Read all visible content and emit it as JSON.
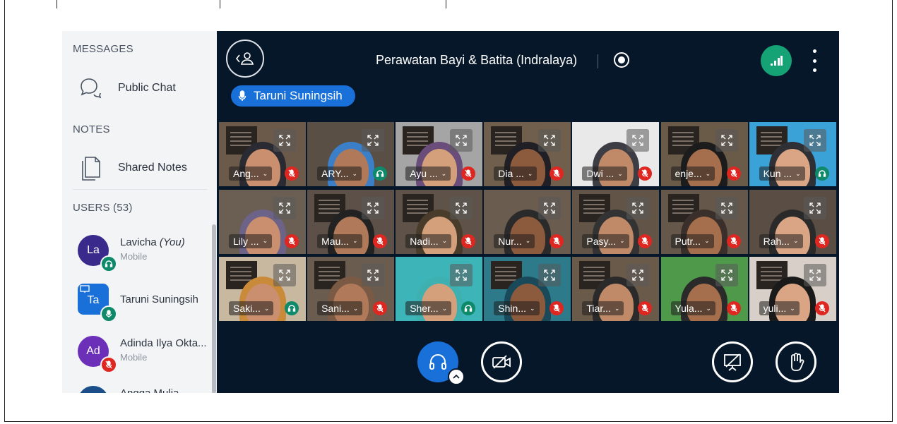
{
  "sidebar": {
    "messages_title": "MESSAGES",
    "public_chat_label": "Public Chat",
    "notes_title": "NOTES",
    "shared_notes_label": "Shared Notes",
    "users_title": "USERS (53)",
    "users": [
      {
        "initials": "La",
        "name": "Lavicha",
        "you_tag": "(You)",
        "device": "Mobile",
        "color": "#3a2a8c",
        "status": "listen"
      },
      {
        "initials": "Ta",
        "name": "Taruni Suningsih",
        "device": "",
        "color": "#1970d8",
        "status": "mic"
      },
      {
        "initials": "Ad",
        "name": "Adinda Ilya Okta...",
        "device": "Mobile",
        "color": "#6b2fb8",
        "status": "muted"
      },
      {
        "initials": "",
        "name": "Angga Mulia",
        "device": "",
        "color": "#1a4f8a",
        "status": ""
      }
    ]
  },
  "header": {
    "meeting_title": "Perawatan Bayi & Batita (Indralaya)",
    "talking_indicator": "Taruni Suningsih"
  },
  "video_tiles": [
    {
      "name": "Ang...",
      "status": "muted"
    },
    {
      "name": "ARY...",
      "status": "listen"
    },
    {
      "name": "Ayu ...",
      "status": "muted"
    },
    {
      "name": "Dia ...",
      "status": "muted"
    },
    {
      "name": "Dwi ...",
      "status": "muted"
    },
    {
      "name": "enje...",
      "status": "muted"
    },
    {
      "name": "Kun ...",
      "status": "listen"
    },
    {
      "name": "Lily ...",
      "status": "muted"
    },
    {
      "name": "Mau...",
      "status": "muted"
    },
    {
      "name": "Nadi...",
      "status": "muted"
    },
    {
      "name": "Nur...",
      "status": "muted"
    },
    {
      "name": "Pasy...",
      "status": "muted"
    },
    {
      "name": "Putr...",
      "status": "muted"
    },
    {
      "name": "Rah...",
      "status": "muted"
    },
    {
      "name": "Saki...",
      "status": "listen"
    },
    {
      "name": "Sani...",
      "status": "muted"
    },
    {
      "name": "Sher...",
      "status": "listen"
    },
    {
      "name": "Shin...",
      "status": "muted"
    },
    {
      "name": "Tiar...",
      "status": "muted"
    },
    {
      "name": "Yula...",
      "status": "muted"
    },
    {
      "name": "yuli...",
      "status": "muted"
    }
  ],
  "colors": {
    "main_bg": "#06172a",
    "accent_blue": "#1970d8",
    "connection_green": "#15a376",
    "muted_red": "#df2721",
    "listen_teal": "#0e8a6a",
    "sidebar_bg": "#f3f4f6"
  }
}
